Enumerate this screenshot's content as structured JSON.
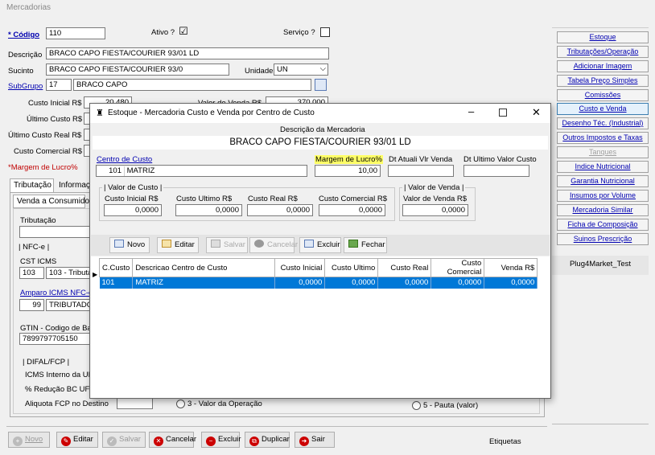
{
  "window_title": "Mercadorias",
  "form": {
    "codigo_label": "* Código",
    "codigo_value": "110",
    "ativo_label": "Ativo ?",
    "ativo_checked": "☑",
    "servico_label": "Serviço ?",
    "descricao_label": "Descrição",
    "descricao_value": "BRACO CAPO FIESTA/COURIER 93/01 LD",
    "sucinto_label": "Sucinto",
    "sucinto_value": "BRACO CAPO FIESTA/COURIER 93/0",
    "unidade_label": "Unidade",
    "unidade_value": "UN",
    "subgrupo_label": "SubGrupo",
    "subgrupo_code": "17",
    "subgrupo_name": "BRACO CAPO",
    "custo_inicial_label": "Custo Inicial R$",
    "custo_inicial_value": "20,480",
    "valor_venda_label": "Valor de Venda R$",
    "valor_venda_value": "370,000",
    "ultimo_custo_label": "Último Custo R$",
    "ultimo_custo_real_label": "Último Custo Real R$",
    "custo_comercial_label": "Custo Comercial R$",
    "margem_label": "*Margem de Lucro%",
    "tabs": [
      "Tributação",
      "Informaç"
    ],
    "subtab": "Venda a Consumidor",
    "tributacao_label": "Tributação",
    "nfce_label": "| NFC-e |",
    "cst_icms_label": "CST ICMS",
    "cst_code": "103",
    "cst_text": "103 - Tributa",
    "amparo_label": "Amparo ICMS NFC-e/N",
    "amparo_code": "99",
    "amparo_text": "TRIBUTADO I",
    "gtin_label": "GTIN - Codigo de Bar",
    "gtin_value": "7899797705150",
    "difal_label": "| DIFAL/FCP |",
    "icms_uf_label": "ICMS Interno da UF",
    "reducao_label": "% Redução BC UF D",
    "aliquota_label": "Aliquota FCP no Destino",
    "radio3_label": "3 - Valor da Operação",
    "radio5_label": "5 - Pauta (valor)"
  },
  "right_panel": {
    "buttons": [
      "Estoque",
      "Tributações/Operação",
      "Adicionar Imagem",
      "Tabela Preço Simples",
      "Comissões",
      "Custo e Venda",
      "Desenho Téc. (Industrial)",
      "Outros Impostos e Taxas",
      "Tanques",
      "Indice Nutricional",
      "Garantia Nutricional",
      "Insumos por Volume",
      "Mercadoria Similar",
      "Ficha de Composição",
      "Suinos Prescrição"
    ],
    "footer": "Plug4Market_Test",
    "etiquetas": "Etiquetas"
  },
  "bottom_toolbar": {
    "novo": "Novo",
    "editar": "Editar",
    "salvar": "Salvar",
    "cancelar": "Cancelar",
    "excluir": "Excluir",
    "duplicar": "Duplicar",
    "sair": "Sair"
  },
  "dialog": {
    "title": "Estoque - Mercadoria Custo e Venda por Centro de Custo",
    "desc_header": "Descrição da Mercadoria",
    "desc_value": "BRACO CAPO FIESTA/COURIER 93/01 LD",
    "centro_custo_label": "Centro de Custo",
    "centro_custo_code": "101",
    "centro_custo_name": "MATRIZ",
    "margem_label": "Margem de Lucro%",
    "margem_value": "10,00",
    "dt_atual_label": "Dt Atuali Vlr Venda",
    "dt_ultimo_label": "Dt Ultimo Valor Custo",
    "valor_custo_group": "| Valor de Custo |",
    "custo_inicial_label": "Custo Inicial R$",
    "custo_inicial_value": "0,0000",
    "custo_ultimo_label": "Custo Ultimo R$",
    "custo_ultimo_value": "0,0000",
    "custo_real_label": "Custo Real R$",
    "custo_real_value": "0,0000",
    "custo_comercial_label": "Custo Comercial R$",
    "custo_comercial_value": "0,0000",
    "valor_venda_group": "| Valor de Venda |",
    "valor_venda_label": "Valor de Venda R$",
    "valor_venda_value": "0,0000",
    "toolbar": {
      "novo": "Novo",
      "editar": "Editar",
      "salvar": "Salvar",
      "cancelar": "Cancelar",
      "excluir": "Excluir",
      "fechar": "Fechar"
    },
    "grid": {
      "columns": [
        "C.Custo",
        "Descricao Centro de Custo",
        "Custo Inicial",
        "Custo Ultimo",
        "Custo Real",
        "Custo Comercial",
        "Venda R$"
      ],
      "rows": [
        [
          "101",
          "MATRIZ",
          "0,0000",
          "0,0000",
          "0,0000",
          "0,0000",
          "0,0000"
        ]
      ]
    }
  }
}
